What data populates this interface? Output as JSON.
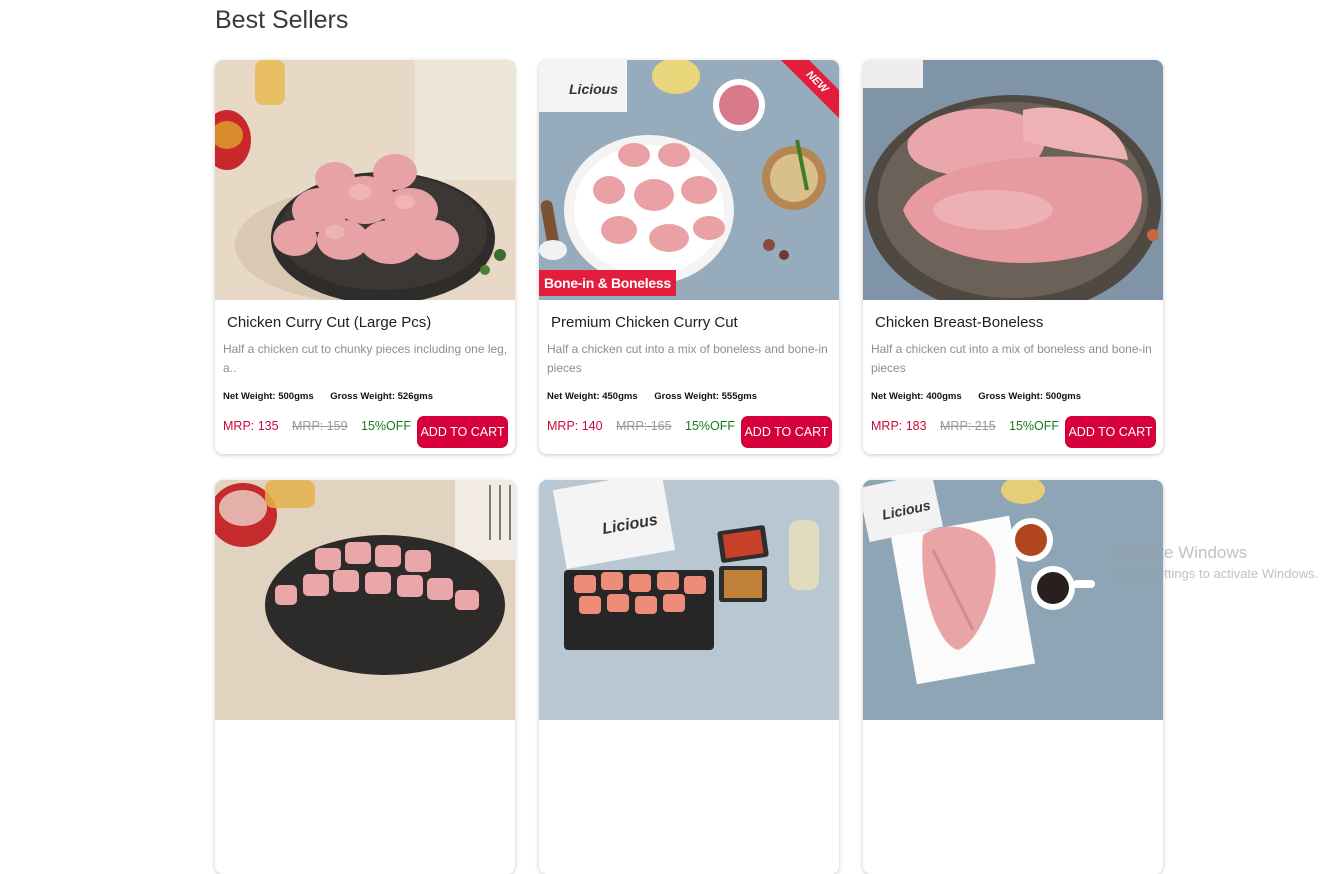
{
  "section": {
    "title": "Best Sellers"
  },
  "products": [
    {
      "name": "Chicken Curry Cut (Large Pcs)",
      "description": "Half a chicken cut to chunky pieces including one leg, a..",
      "net_weight": "Net Weight: 500gms",
      "gross_weight": "Gross Weight: 526gms",
      "price": "MRP: 135",
      "mrp": "MRP: 159",
      "discount": "15%OFF",
      "button": "ADD TO CART"
    },
    {
      "name": "Premium Chicken Curry Cut",
      "description": "Half a chicken cut into a mix of boneless and bone-in pieces",
      "net_weight": "Net Weight: 450gms",
      "gross_weight": "Gross Weight: 555gms",
      "price": "MRP: 140",
      "mrp": "MRP: 165",
      "discount": "15%OFF",
      "button": "ADD TO CART",
      "badge_new": "NEW",
      "badge_tag": "Bone-in & Boneless"
    },
    {
      "name": "Chicken Breast-Boneless",
      "description": "Half a chicken cut into a mix of boneless and bone-in pieces",
      "net_weight": "Net Weight: 400gms",
      "gross_weight": "Gross Weight: 500gms",
      "price": "MRP: 183",
      "mrp": "MRP: 215",
      "discount": "15%OFF",
      "button": "ADD TO CART"
    }
  ],
  "watermark": {
    "line1": "Activate Windows",
    "line2": "Go to Settings to activate Windows."
  }
}
